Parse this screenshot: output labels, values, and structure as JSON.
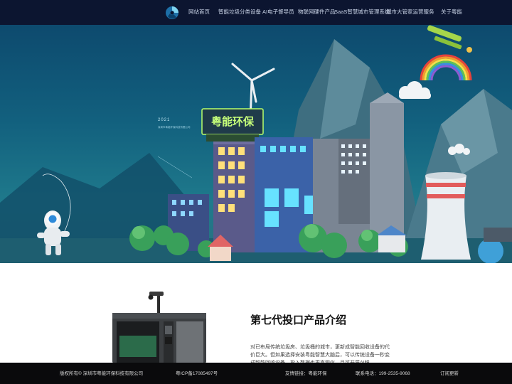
{
  "header": {
    "nav": [
      {
        "label": "网站首页"
      },
      {
        "label": "智能垃圾分类设备"
      },
      {
        "label": "AI电子督导员"
      },
      {
        "label": "物联网硬件产品"
      },
      {
        "label": "SaaS智慧城市管理系统"
      },
      {
        "label": "城市大管家运营服务"
      },
      {
        "label": "关于粤能"
      }
    ]
  },
  "hero": {
    "year": "2021",
    "caption": "深圳市粤能环保科技有限公司",
    "billboard": "粤能环保"
  },
  "product_section": {
    "title": "第七代投口产品介绍",
    "body": "对已布局传统垃圾房、垃圾桶的城市，更新成智能回收设备的代价巨大。但如果选择安装粤能智慧大脑后，可以传统设备一秒变成智能回收设备，投入数据也更直观化，且可开展AI积"
  },
  "footer": {
    "copyright": "版权所有© 深圳市粤能环保科技有限公司",
    "icp": "粤ICP备17085497号",
    "links": "友情链接：粤能环保",
    "phone": "联系电话：199-2535-9068",
    "subscribe": "订阅更新"
  }
}
